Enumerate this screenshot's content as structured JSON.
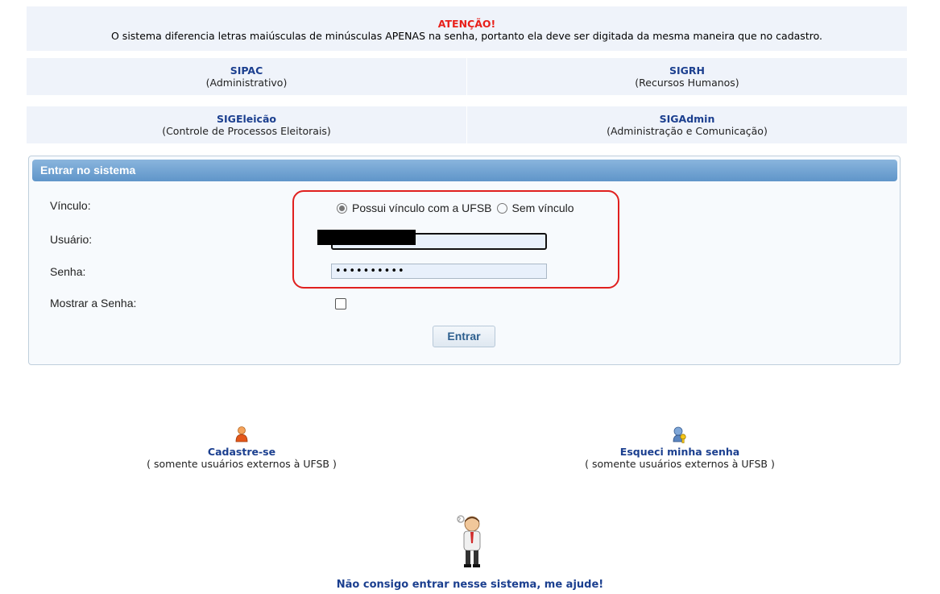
{
  "notice": {
    "title": "ATENÇÃO!",
    "text": "O sistema diferencia letras maiúsculas de minúsculas APENAS na senha, portanto ela deve ser digitada da mesma maneira que no cadastro."
  },
  "systems": [
    {
      "name": "SIPAC",
      "desc": "(Administrativo)"
    },
    {
      "name": "SIGRH",
      "desc": "(Recursos Humanos)"
    },
    {
      "name": "SIGEleicão",
      "desc": "(Controle de Processos Eleitorais)"
    },
    {
      "name": "SIGAdmin",
      "desc": "(Administração e Comunicação)"
    }
  ],
  "login": {
    "header": "Entrar no sistema",
    "vinculo_label": "Vínculo:",
    "vinculo_opt1": "Possui vínculo com a UFSB",
    "vinculo_opt2": "Sem vínculo",
    "vinculo_selected": "Possui vínculo com a UFSB",
    "usuario_label": "Usuário:",
    "usuario_value": "",
    "senha_label": "Senha:",
    "senha_value": "••••••••••",
    "mostrar_label": "Mostrar a Senha:",
    "submit": "Entrar"
  },
  "external": {
    "register_label": "Cadastre-se",
    "register_sub": "( somente usuários externos à UFSB )",
    "forgot_label": "Esqueci minha senha",
    "forgot_sub": "( somente usuários externos à UFSB )"
  },
  "help": {
    "label": "Não consigo entrar nesse sistema, me ajude!"
  },
  "colors": {
    "accent": "#1b3f8f",
    "warning": "#e8201a",
    "highlight": "#e0201f",
    "header_gradient": "#6a9fd1"
  }
}
